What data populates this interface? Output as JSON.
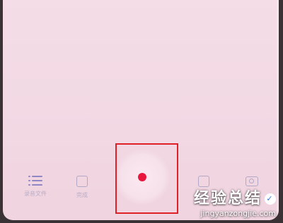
{
  "toolbar": {
    "recorded_files_label": "录音文件",
    "done_label": "完成"
  },
  "watermark": {
    "name": "经验总结",
    "url": "jingyanzongjie.com"
  },
  "colors": {
    "record_dot": "#e8153d",
    "highlight_border": "#e02027",
    "icon_tint": "#8f86c4"
  },
  "icons": [
    "list-icon",
    "square-icon",
    "record-icon",
    "camera-icon"
  ]
}
